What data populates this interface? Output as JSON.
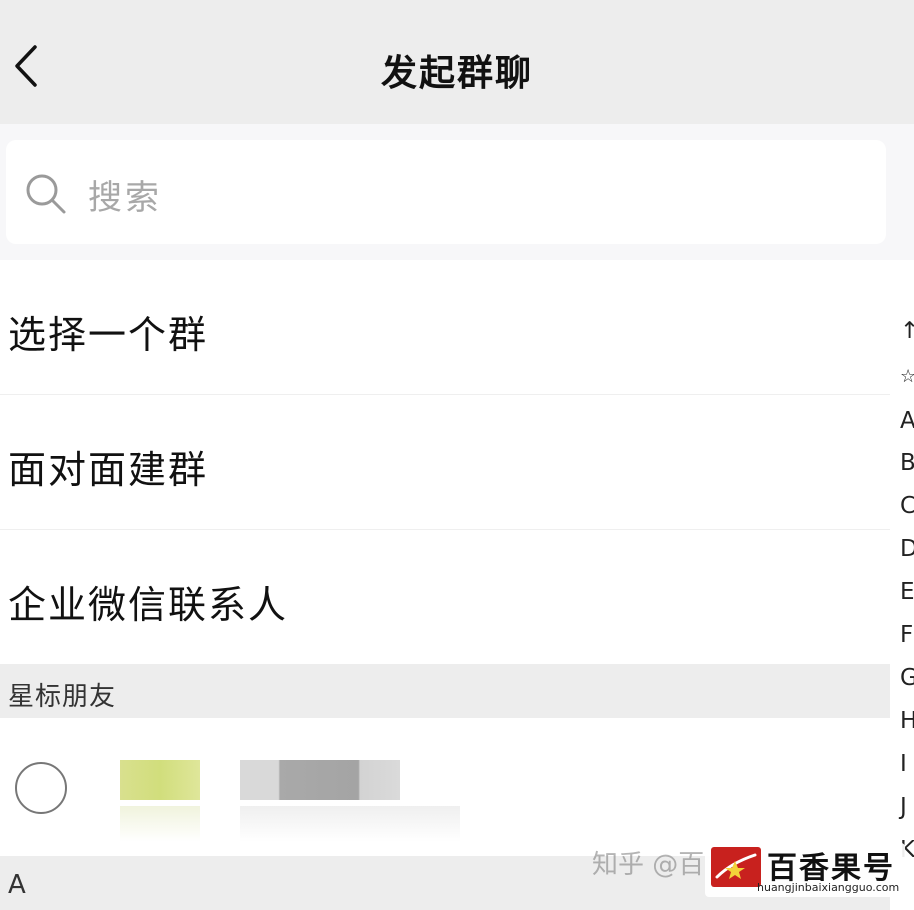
{
  "navbar": {
    "title": "发起群聊"
  },
  "search": {
    "placeholder": "搜索"
  },
  "menu": {
    "items": [
      {
        "label": "选择一个群"
      },
      {
        "label": "面对面建群"
      },
      {
        "label": "企业微信联系人"
      }
    ]
  },
  "sections": {
    "starred": {
      "title": "星标朋友"
    },
    "a": {
      "title": "A"
    }
  },
  "index_bar": {
    "items": [
      "↑",
      "☆",
      "A",
      "B",
      "C",
      "D",
      "E",
      "F",
      "G",
      "H",
      "I",
      "J",
      "K"
    ]
  },
  "watermark": {
    "text": "知乎 @百",
    "brand_name": "百香果号",
    "brand_url": "huangjinbaixiangguo.com"
  },
  "colors": {
    "navbar_bg": "#ededed",
    "section_bg": "#ededed",
    "brand_red": "#c8211e"
  }
}
